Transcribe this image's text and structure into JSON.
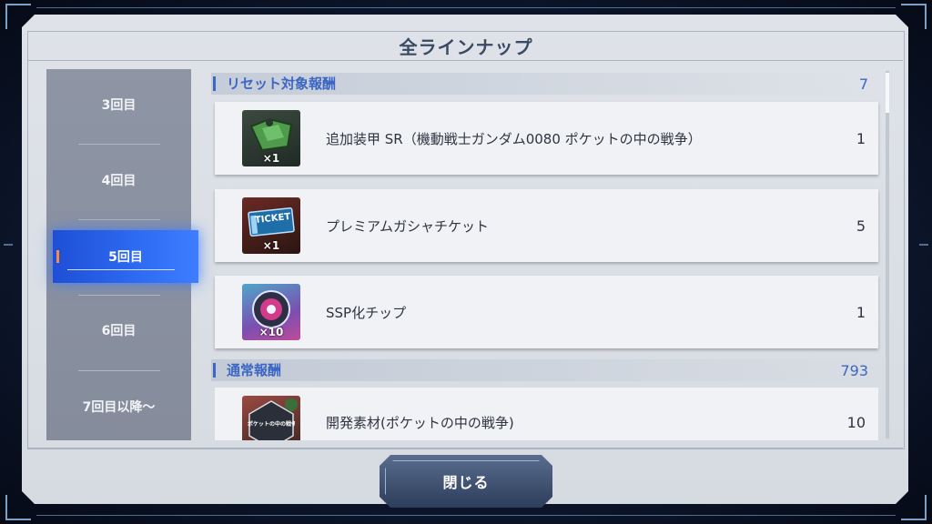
{
  "dialog": {
    "title": "全ラインナップ"
  },
  "sidebar": {
    "items": [
      {
        "label": "3回目"
      },
      {
        "label": "4回目"
      },
      {
        "label": "5回目",
        "active": true
      },
      {
        "label": "6回目"
      },
      {
        "label": "7回目以降〜"
      }
    ]
  },
  "sections": [
    {
      "label": "リセット対象報酬",
      "count": "7",
      "rows": [
        {
          "name": "追加装甲 SR（機動戦士ガンダム0080 ポケットの中の戦争）",
          "qty": "1",
          "icon": "armor-icon",
          "mult": "×1"
        },
        {
          "name": "プレミアムガシャチケット",
          "qty": "5",
          "icon": "ticket-icon",
          "mult": "×1",
          "icon_text": "TICKET"
        },
        {
          "name": "SSP化チップ",
          "qty": "1",
          "icon": "chip-icon",
          "mult": "×10"
        }
      ]
    },
    {
      "label": "通常報酬",
      "count": "793",
      "rows": [
        {
          "name": "開発素材(ポケットの中の戦争)",
          "qty": "10",
          "icon": "material-icon",
          "icon_text": "ポケットの中の戦争"
        }
      ]
    }
  ],
  "footer": {
    "close_label": "閉じる"
  },
  "colors": {
    "accent": "#2d6cf3",
    "section": "#3b66c4",
    "panel": "#dfe3e9"
  }
}
